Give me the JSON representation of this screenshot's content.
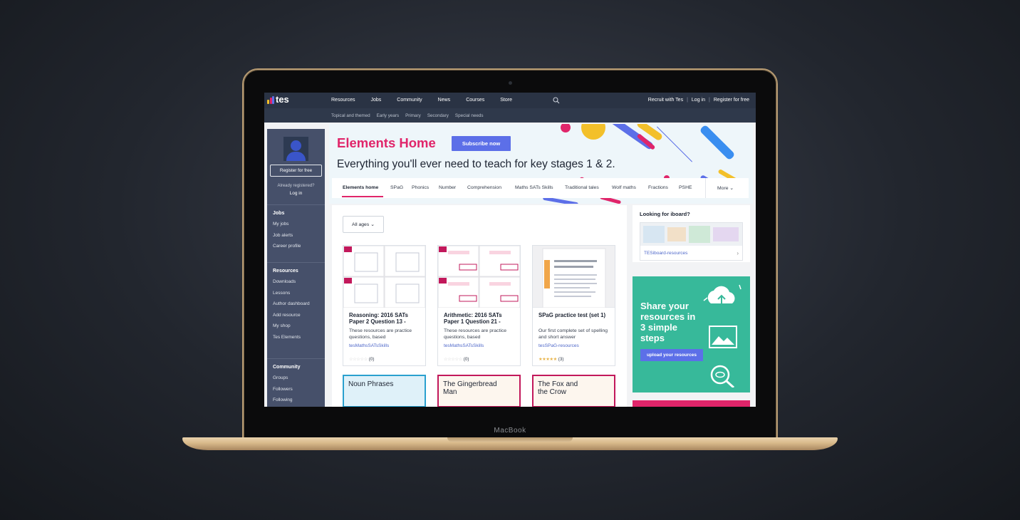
{
  "device": {
    "brand_label": "MacBook"
  },
  "topbar": {
    "logo_text": "tes",
    "main_nav": [
      "Resources",
      "Jobs",
      "Community",
      "News",
      "Courses",
      "Store"
    ],
    "right_nav": {
      "recruit": "Recruit with Tes",
      "login": "Log in",
      "register": "Register for free",
      "separator": "|"
    },
    "search_icon": "search-icon"
  },
  "subnav": [
    "Topical and themed",
    "Early years",
    "Primary",
    "Secondary",
    "Special needs"
  ],
  "sidebar": {
    "register_button": "Register for free",
    "already_registered": "Already registered?",
    "login": "Log in",
    "jobs": {
      "heading": "Jobs",
      "items": [
        "My jobs",
        "Job alerts",
        "Career profile"
      ]
    },
    "resources": {
      "heading": "Resources",
      "items": [
        "Downloads",
        "Lessons",
        "Author dashboard",
        "Add resource",
        "My shop",
        "Tes Elements"
      ]
    },
    "community": {
      "heading": "Community",
      "items": [
        "Groups",
        "Followers",
        "Following"
      ]
    }
  },
  "banner": {
    "title": "Elements Home",
    "subscribe": "Subscribe now",
    "tagline": "Everything you'll ever need to teach for key stages 1 & 2."
  },
  "tabs": {
    "items": [
      "Elements home",
      "SPaG",
      "Phonics",
      "Number",
      "Comprehension",
      "Maths SATs Skills",
      "Traditional tales",
      "Wolf maths",
      "Fractions",
      "PSHE"
    ],
    "active": "Elements home",
    "more": "More"
  },
  "filter": {
    "age_select": "All ages"
  },
  "cards": [
    {
      "title": "Reasoning: 2016 SATs Paper 2 Question 13 -",
      "desc": "These resources are practice questions, based",
      "author": "tesMathsSATsSkills",
      "rating": "☆☆☆☆☆",
      "count": "(0)"
    },
    {
      "title": "Arithmetic: 2016 SATs Paper 1 Question 21 -",
      "desc": "These resources are practice questions, based",
      "author": "tesMathsSATsSkills",
      "rating": "☆☆☆☆☆",
      "count": "(0)"
    },
    {
      "title": "SPaG practice test (set 1)",
      "desc": "Our first complete set of spelling and short answer",
      "author": "tesSPaG-resources",
      "rating": "★★★★★",
      "count": "(3)"
    }
  ],
  "cards_row2": [
    {
      "title": "Noun Phrases",
      "color": "#2aa0cf"
    },
    {
      "title": "The Gingerbread Man",
      "color": "#c2185b"
    },
    {
      "title": "The Fox and the Crow",
      "color": "#c2185b"
    }
  ],
  "iboard": {
    "title": "Looking for iboard?",
    "link": "TESiboard-resources"
  },
  "share": {
    "text": "Share your resources in 3 simple steps",
    "button": "upload your resources"
  },
  "colors": {
    "brand_pink": "#e0256a",
    "accent_blue": "#5c6fe8",
    "teal": "#37b99a",
    "nav_dark": "#2a3344",
    "sidebar": "#46506a"
  }
}
